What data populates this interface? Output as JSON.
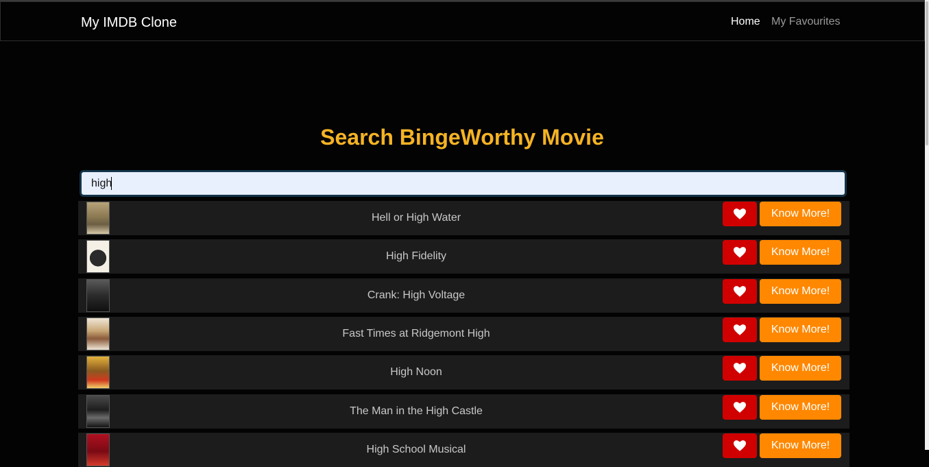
{
  "navbar": {
    "brand": "My IMDB Clone",
    "links": [
      "Home",
      "My Favourites"
    ]
  },
  "heading": "Search BingeWorthy Movie",
  "search": {
    "value": "high"
  },
  "results": [
    {
      "title": "Hell or High Water",
      "poster": "poster-image",
      "fav_icon": "heart-icon",
      "action": "Know More!"
    },
    {
      "title": "High Fidelity",
      "poster": "poster-image",
      "fav_icon": "heart-icon",
      "action": "Know More!"
    },
    {
      "title": "Crank: High Voltage",
      "poster": "poster-image",
      "fav_icon": "heart-icon",
      "action": "Know More!"
    },
    {
      "title": "Fast Times at Ridgemont High",
      "poster": "poster-image",
      "fav_icon": "heart-icon",
      "action": "Know More!"
    },
    {
      "title": "High Noon",
      "poster": "poster-image",
      "fav_icon": "heart-icon",
      "action": "Know More!"
    },
    {
      "title": "The Man in the High Castle",
      "poster": "poster-image",
      "fav_icon": "heart-icon",
      "action": "Know More!"
    },
    {
      "title": "High School Musical",
      "poster": "poster-image",
      "fav_icon": "heart-icon",
      "action": "Know More!"
    }
  ],
  "colors": {
    "background": "#030303",
    "heading": "#f5b324",
    "favourite_button": "#d10000",
    "know_more_button": "#ff8800",
    "row": "#1c1c1c"
  }
}
